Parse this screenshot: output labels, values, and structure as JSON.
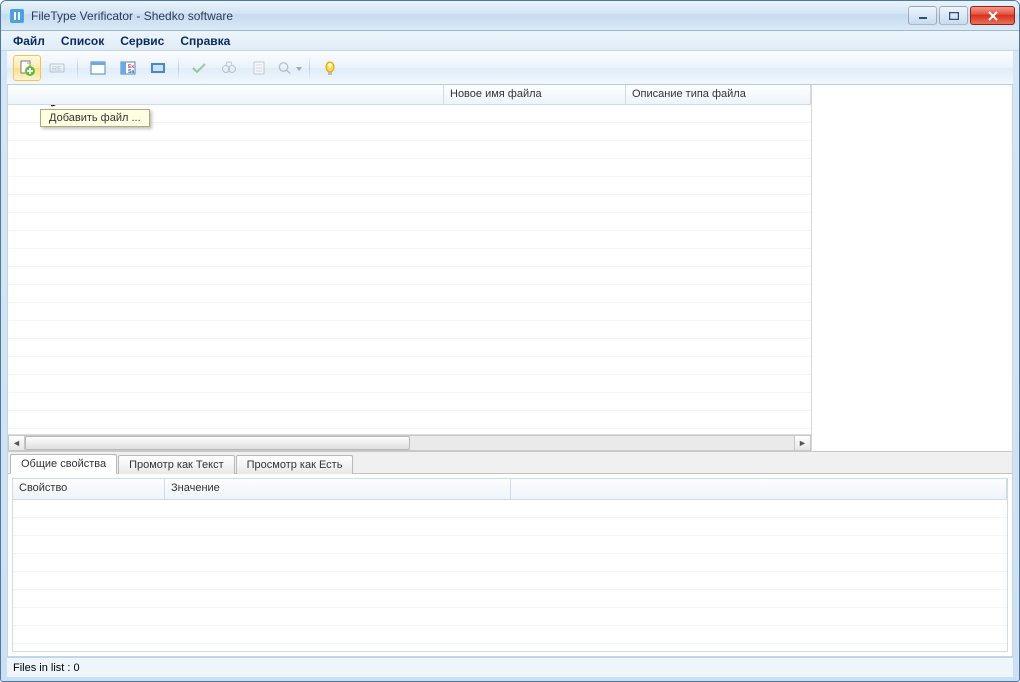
{
  "window": {
    "title": "FileType Verificator - Shedko software"
  },
  "menu": {
    "file": "Файл",
    "list": "Список",
    "service": "Сервис",
    "help": "Справка"
  },
  "toolbar": {
    "tooltip_add_file": "Добавить файл ..."
  },
  "grid": {
    "columns": {
      "c0": "",
      "c1": "Новое имя файла",
      "c2": "Описание типа файла"
    }
  },
  "tabs": {
    "general": "Общие свойства",
    "view_text": "Промотр как Текст",
    "view_asis": "Просмотр как Есть"
  },
  "properties": {
    "columns": {
      "name": "Свойство",
      "value": "Значение"
    }
  },
  "status": {
    "files_in_list": "Files in list : 0"
  }
}
